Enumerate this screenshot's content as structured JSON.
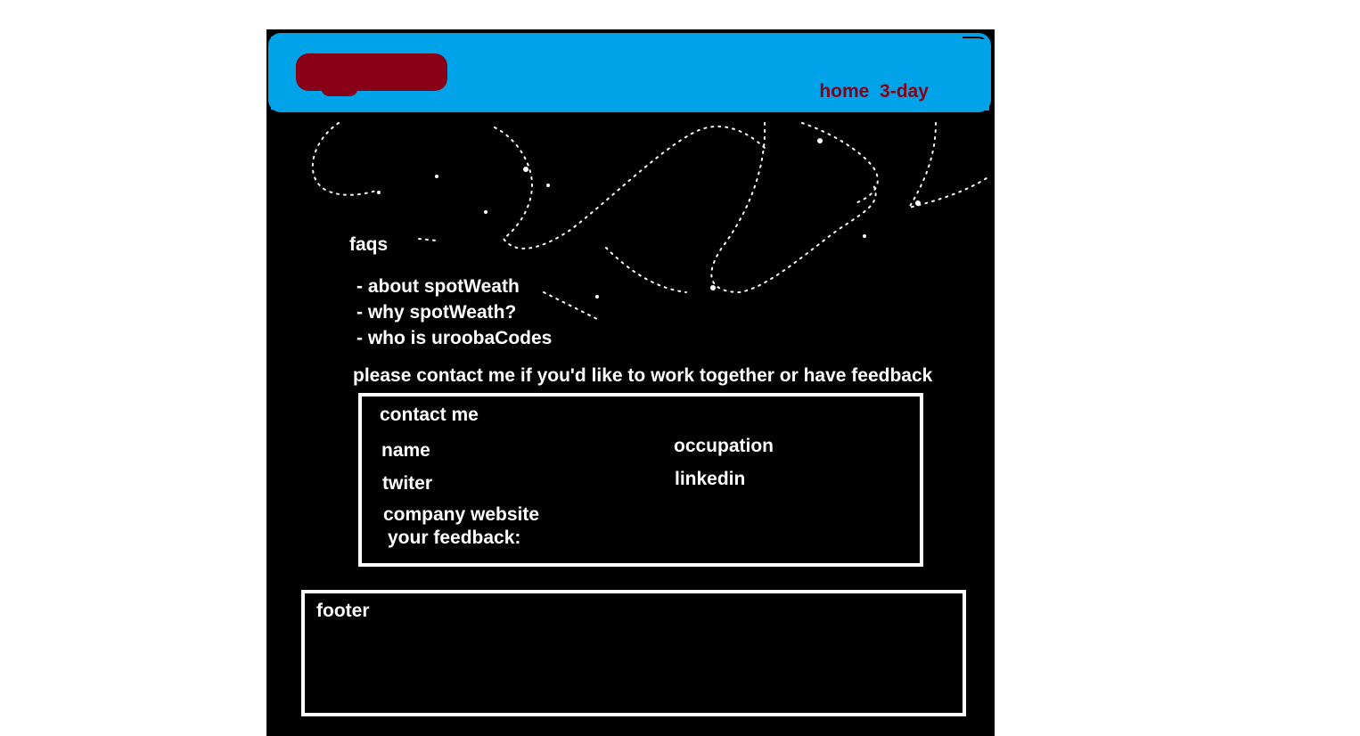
{
  "header": {
    "nav_home": "home",
    "nav_3day": "3-day",
    "accent_color": "#00a2e8",
    "brand_color": "#880015"
  },
  "faqs": {
    "title": "faqs",
    "items": [
      "- about spotWeath",
      "- why spotWeath?",
      "- who is uroobaCodes"
    ]
  },
  "contact_prompt": "please contact me if you'd like to work together or have feedback",
  "contact_form": {
    "title": "contact me",
    "name_label": "name",
    "occupation_label": "occupation",
    "twitter_label": "twiter",
    "linkedin_label": "linkedin",
    "company_label": "company website",
    "feedback_label": "your feedback:"
  },
  "footer": {
    "label": "footer"
  }
}
